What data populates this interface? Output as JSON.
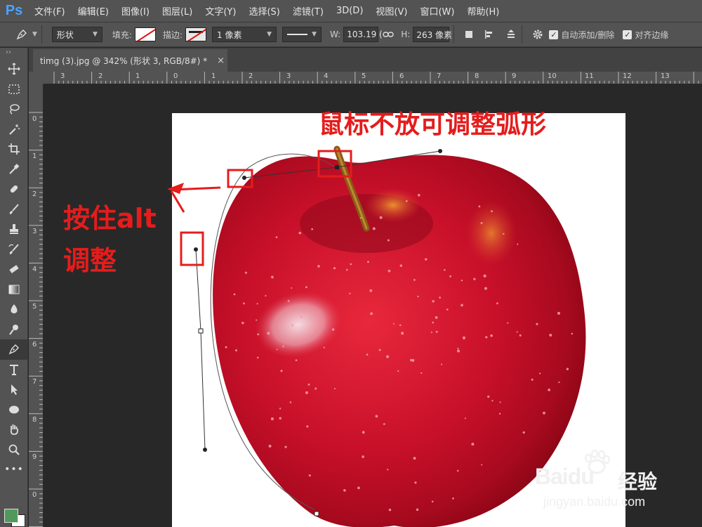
{
  "app": {
    "logo": "Ps",
    "menu": [
      "文件(F)",
      "编辑(E)",
      "图像(I)",
      "图层(L)",
      "文字(Y)",
      "选择(S)",
      "滤镜(T)",
      "3D(D)",
      "视图(V)",
      "窗口(W)",
      "帮助(H)"
    ]
  },
  "options": {
    "mode": "形状",
    "fill_label": "填充:",
    "stroke_label": "描边:",
    "stroke_width": "1 像素",
    "w_label": "W:",
    "w_value": "103.19 (",
    "h_label": "H:",
    "h_value": "263 像素",
    "auto_add_delete": "自动添加/删除",
    "align_edges": "对齐边缘",
    "colors": {
      "fill_none_slash": "#e01010"
    }
  },
  "document": {
    "tab_title": "timg (3).jpg @ 342% (形状 3, RGB/8#) *",
    "close": "×"
  },
  "rulers": {
    "horizontal": [
      "3",
      "2",
      "1",
      "0",
      "1",
      "2",
      "3",
      "4",
      "5",
      "6",
      "7",
      "8",
      "9",
      "10",
      "11",
      "12",
      "13"
    ],
    "vertical": [
      "0",
      "1",
      "2",
      "3",
      "4",
      "5",
      "6",
      "7",
      "8",
      "9",
      "0"
    ]
  },
  "annotations": {
    "top": "鼠标不放可调整弧形",
    "left_line1": "按住alt",
    "left_line2": "调整",
    "color": "#e51c1c"
  },
  "watermark": {
    "brand": "Baidu",
    "suffix": "经验",
    "url": "jingyan.baidu.com"
  },
  "tools": [
    "move-icon",
    "marquee-icon",
    "lasso-icon",
    "magic-wand-icon",
    "crop-icon",
    "eyedropper-icon",
    "healing-icon",
    "brush-icon",
    "stamp-icon",
    "history-brush-icon",
    "eraser-icon",
    "gradient-icon",
    "blur-icon",
    "dodge-icon",
    "pen-icon",
    "type-icon",
    "path-select-icon",
    "ellipse-icon",
    "hand-icon",
    "zoom-icon",
    "more-icon"
  ],
  "swatches": {
    "foreground": "#4f9a5a",
    "background": "#ffffff"
  }
}
